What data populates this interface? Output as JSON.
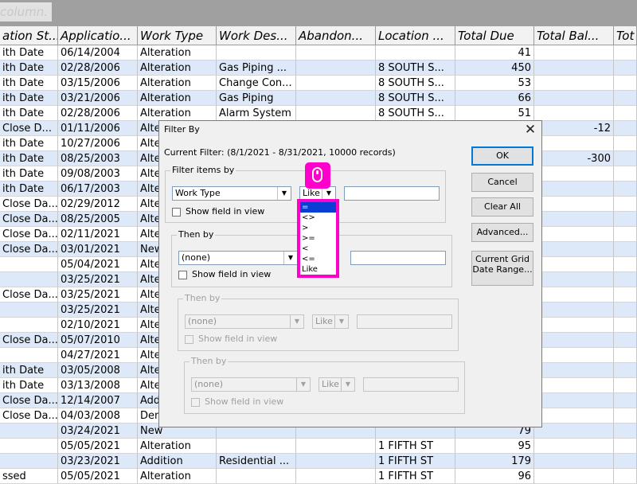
{
  "group_hint": "column.",
  "columns": [
    "ation St...",
    "Applicatio...",
    "Work Type",
    "Work Des...",
    "Abandon...",
    "Location ...",
    "Total Due",
    "Total Bal...",
    "Tot"
  ],
  "rows": [
    {
      "c0": "ith Date",
      "c1": "06/14/2004",
      "c2": "Alteration",
      "c3": "",
      "c4": "",
      "c5": "",
      "c6": "41",
      "c7": ""
    },
    {
      "c0": "ith Date",
      "c1": "02/28/2006",
      "c2": "Alteration",
      "c3": "Gas Piping ...",
      "c4": "",
      "c5": "8 SOUTH S...",
      "c6": "450",
      "c7": ""
    },
    {
      "c0": "ith Date",
      "c1": "03/15/2006",
      "c2": "Alteration",
      "c3": "Change Con...",
      "c4": "",
      "c5": "8 SOUTH S...",
      "c6": "53",
      "c7": ""
    },
    {
      "c0": "ith Date",
      "c1": "03/21/2006",
      "c2": "Alteration",
      "c3": "Gas Piping",
      "c4": "",
      "c5": "8 SOUTH S...",
      "c6": "66",
      "c7": ""
    },
    {
      "c0": "ith Date",
      "c1": "02/28/2006",
      "c2": "Alteration",
      "c3": "Alarm System",
      "c4": "",
      "c5": "8 SOUTH S...",
      "c6": "51",
      "c7": ""
    },
    {
      "c0": "Close D...",
      "c1": "01/11/2006",
      "c2": "Alte",
      "c3": "",
      "c4": "",
      "c5": "",
      "c6": "",
      "c7": "-12"
    },
    {
      "c0": "ith Date",
      "c1": "10/27/2006",
      "c2": "Alte",
      "c3": "",
      "c4": "",
      "c5": "",
      "c6": "",
      "c7": ""
    },
    {
      "c0": "ith Date",
      "c1": "08/25/2003",
      "c2": "Alte",
      "c3": "",
      "c4": "",
      "c5": "",
      "c6": "",
      "c7": "-300"
    },
    {
      "c0": "ith Date",
      "c1": "09/08/2003",
      "c2": "Alte",
      "c3": "",
      "c4": "",
      "c5": "",
      "c6": "",
      "c7": ""
    },
    {
      "c0": "ith Date",
      "c1": "06/17/2003",
      "c2": "Alte",
      "c3": "",
      "c4": "",
      "c5": "",
      "c6": "",
      "c7": ""
    },
    {
      "c0": "Close Da...",
      "c1": "02/29/2012",
      "c2": "Alte",
      "c3": "",
      "c4": "",
      "c5": "",
      "c6": "",
      "c7": ""
    },
    {
      "c0": "Close Da...",
      "c1": "08/25/2005",
      "c2": "Alte",
      "c3": "",
      "c4": "",
      "c5": "",
      "c6": "",
      "c7": ""
    },
    {
      "c0": "Close Da...",
      "c1": "02/11/2021",
      "c2": "Alte",
      "c3": "",
      "c4": "",
      "c5": "",
      "c6": "",
      "c7": ""
    },
    {
      "c0": "Close Da...",
      "c1": "03/01/2021",
      "c2": "New",
      "c3": "",
      "c4": "",
      "c5": "",
      "c6": "",
      "c7": ""
    },
    {
      "c0": "",
      "c1": "05/04/2021",
      "c2": "Alte",
      "c3": "",
      "c4": "",
      "c5": "",
      "c6": "",
      "c7": ""
    },
    {
      "c0": "",
      "c1": "03/25/2021",
      "c2": "Alte",
      "c3": "",
      "c4": "",
      "c5": "",
      "c6": "",
      "c7": ""
    },
    {
      "c0": "Close Da...",
      "c1": "03/25/2021",
      "c2": "Alte",
      "c3": "",
      "c4": "",
      "c5": "",
      "c6": "",
      "c7": ""
    },
    {
      "c0": "",
      "c1": "03/25/2021",
      "c2": "Alte",
      "c3": "",
      "c4": "",
      "c5": "",
      "c6": "",
      "c7": ""
    },
    {
      "c0": "",
      "c1": "02/10/2021",
      "c2": "Alte",
      "c3": "",
      "c4": "",
      "c5": "",
      "c6": "",
      "c7": ""
    },
    {
      "c0": "Close Da...",
      "c1": "05/07/2010",
      "c2": "Alte",
      "c3": "",
      "c4": "",
      "c5": "",
      "c6": "",
      "c7": ""
    },
    {
      "c0": "",
      "c1": "04/27/2021",
      "c2": "Alte",
      "c3": "",
      "c4": "",
      "c5": "",
      "c6": "",
      "c7": ""
    },
    {
      "c0": "ith Date",
      "c1": "03/05/2008",
      "c2": "Alte",
      "c3": "",
      "c4": "",
      "c5": "",
      "c6": "",
      "c7": ""
    },
    {
      "c0": "ith Date",
      "c1": "03/13/2008",
      "c2": "Alte",
      "c3": "",
      "c4": "",
      "c5": "",
      "c6": "",
      "c7": ""
    },
    {
      "c0": "Close Da...",
      "c1": "12/14/2007",
      "c2": "Add",
      "c3": "",
      "c4": "",
      "c5": "",
      "c6": "",
      "c7": ""
    },
    {
      "c0": "Close Da...",
      "c1": "04/03/2008",
      "c2": "Dem",
      "c3": "",
      "c4": "",
      "c5": "",
      "c6": "",
      "c7": ""
    },
    {
      "c0": "",
      "c1": "03/24/2021",
      "c2": "New",
      "c3": "",
      "c4": "",
      "c5": "",
      "c6": "79",
      "c7": ""
    },
    {
      "c0": "",
      "c1": "05/05/2021",
      "c2": "Alteration",
      "c3": "",
      "c4": "",
      "c5": "1 FIFTH ST",
      "c6": "95",
      "c7": ""
    },
    {
      "c0": "",
      "c1": "03/23/2021",
      "c2": "Addition",
      "c3": "Residential ...",
      "c4": "",
      "c5": "1 FIFTH ST",
      "c6": "179",
      "c7": ""
    },
    {
      "c0": "ssed",
      "c1": "05/05/2021",
      "c2": "Alteration",
      "c3": "",
      "c4": "",
      "c5": "1 FIFTH ST",
      "c6": "96",
      "c7": ""
    }
  ],
  "dialog": {
    "title": "Filter By",
    "current_filter": "Current Filter: (8/1/2021 - 8/31/2021, 10000 records)",
    "filter_items_by": "Filter items by",
    "then_by": "Then by",
    "show_field": "Show field in view",
    "field1": "Work Type",
    "op1": "Like",
    "field2": "(none)",
    "field3": "(none)",
    "op3": "Like",
    "field4": "(none)",
    "op4": "Like",
    "ok": "OK",
    "cancel": "Cancel",
    "clear_all": "Clear All",
    "advanced": "Advanced...",
    "current_grid_line1": "Current Grid",
    "current_grid_line2": "Date Range..."
  },
  "operators": [
    "=",
    "<>",
    ">",
    ">=",
    "<",
    "<=",
    "Like"
  ],
  "colors": {
    "row_alt": "#dde9f8",
    "highlight": "#ff00cc",
    "selected": "#0a3fd6"
  }
}
